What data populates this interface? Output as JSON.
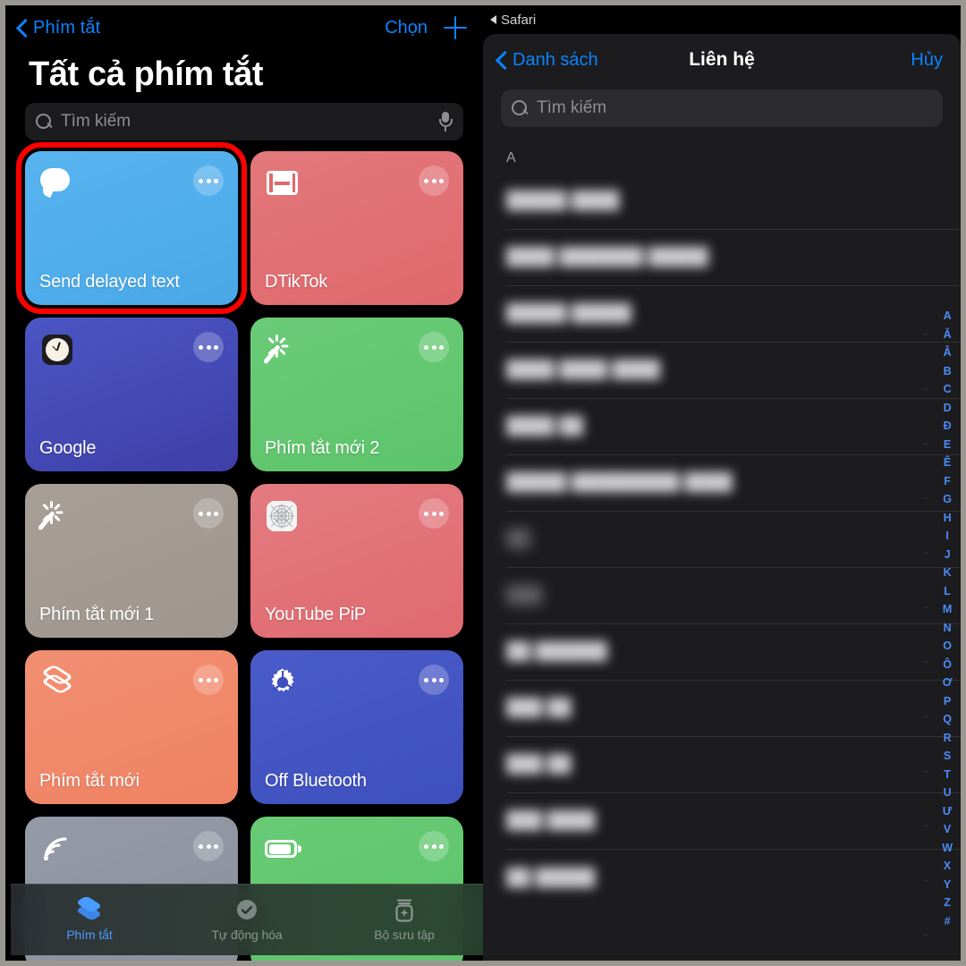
{
  "left_panel": {
    "nav": {
      "back_label": "Phím tắt",
      "back_icon": "chevron-left-icon",
      "choose_label": "Chọn",
      "add_icon": "plus-icon"
    },
    "title": "Tất cả phím tắt",
    "search": {
      "placeholder": "Tìm kiếm",
      "icon": "search-icon",
      "mic_icon": "microphone-icon"
    },
    "shortcuts": [
      {
        "label": "Send delayed text",
        "color": "#4aa8e8",
        "color2": "#58b4ef",
        "icon": "message-bubble-icon",
        "selected": true
      },
      {
        "label": "DTikTok",
        "color": "#e0686c",
        "color2": "#e2787b",
        "icon": "film-strip-icon",
        "selected": false
      },
      {
        "label": "Google",
        "color": "#3f3fa8",
        "color2": "#4a56c4",
        "icon": "clock-app-icon",
        "selected": false
      },
      {
        "label": "Phím tắt mới 2",
        "color": "#5cc46a",
        "color2": "#6acb77",
        "icon": "magic-wand-icon",
        "selected": false
      },
      {
        "label": "Phím tắt mới 1",
        "color": "#9f968f",
        "color2": "#a79e96",
        "icon": "magic-wand-icon",
        "selected": false
      },
      {
        "label": "YouTube PiP",
        "color": "#e06a70",
        "color2": "#e37b80",
        "icon": "sphere-grid-icon",
        "selected": false
      },
      {
        "label": "Phím tắt mới",
        "color": "#ef8263",
        "color2": "#f28f71",
        "icon": "layers-icon",
        "selected": false
      },
      {
        "label": "Off Bluetooth",
        "color": "#3e4fbe",
        "color2": "#4a5cc9",
        "icon": "gear-icon",
        "selected": false
      },
      {
        "label": "",
        "color": "#8a909c",
        "color2": "#949aa6",
        "icon": "broadcast-icon",
        "selected": false
      },
      {
        "label": "",
        "color": "#5cc46a",
        "color2": "#68cb75",
        "icon": "battery-icon",
        "selected": false
      }
    ],
    "tabs": [
      {
        "label": "Phím tắt",
        "icon": "layers-icon",
        "active": true
      },
      {
        "label": "Tự động hóa",
        "icon": "checkmark-clock-icon",
        "active": false
      },
      {
        "label": "Bộ sưu tập",
        "icon": "jar-sparkle-icon",
        "active": false
      }
    ]
  },
  "right_panel": {
    "status_bar": {
      "back_app_label": "Safari",
      "back_icon": "back-triangle-icon"
    },
    "nav": {
      "back_label": "Danh sách",
      "back_icon": "chevron-left-icon",
      "title": "Liên hệ",
      "cancel_label": "Hủy"
    },
    "search": {
      "placeholder": "Tìm kiếm",
      "icon": "search-icon"
    },
    "section_header": "A",
    "contacts": [
      {
        "name": "█████ ████",
        "redacted": true
      },
      {
        "name": "████ ███████ █████",
        "redacted": true
      },
      {
        "name": "█████ █████",
        "redacted": true
      },
      {
        "name": "████ ████ ████",
        "redacted": true
      },
      {
        "name": "████ ██",
        "redacted": true
      },
      {
        "name": "█████ █████████ ████",
        "redacted": true
      },
      {
        "name": "██",
        "redacted": true
      },
      {
        "name": "███",
        "redacted": true
      },
      {
        "name": "██ ██████",
        "redacted": true
      },
      {
        "name": "███ ██",
        "redacted": true
      },
      {
        "name": "███ ██",
        "redacted": true
      },
      {
        "name": "███ ████",
        "redacted": true
      },
      {
        "name": "██ █████",
        "redacted": true
      }
    ],
    "alphabet_index": [
      "A",
      "Ă",
      "Â",
      "B",
      "C",
      "D",
      "Đ",
      "E",
      "Ê",
      "F",
      "G",
      "H",
      "I",
      "J",
      "K",
      "L",
      "M",
      "N",
      "O",
      "Ô",
      "Ơ",
      "P",
      "Q",
      "R",
      "S",
      "T",
      "U",
      "Ư",
      "V",
      "W",
      "X",
      "Y",
      "Z",
      "#"
    ]
  },
  "colors": {
    "accent_blue": "#0a84ff",
    "selection_red": "#ff0000",
    "bg_black": "#000000",
    "sheet_bg": "#1c1c1e",
    "frame_grey": "#9a9792"
  }
}
